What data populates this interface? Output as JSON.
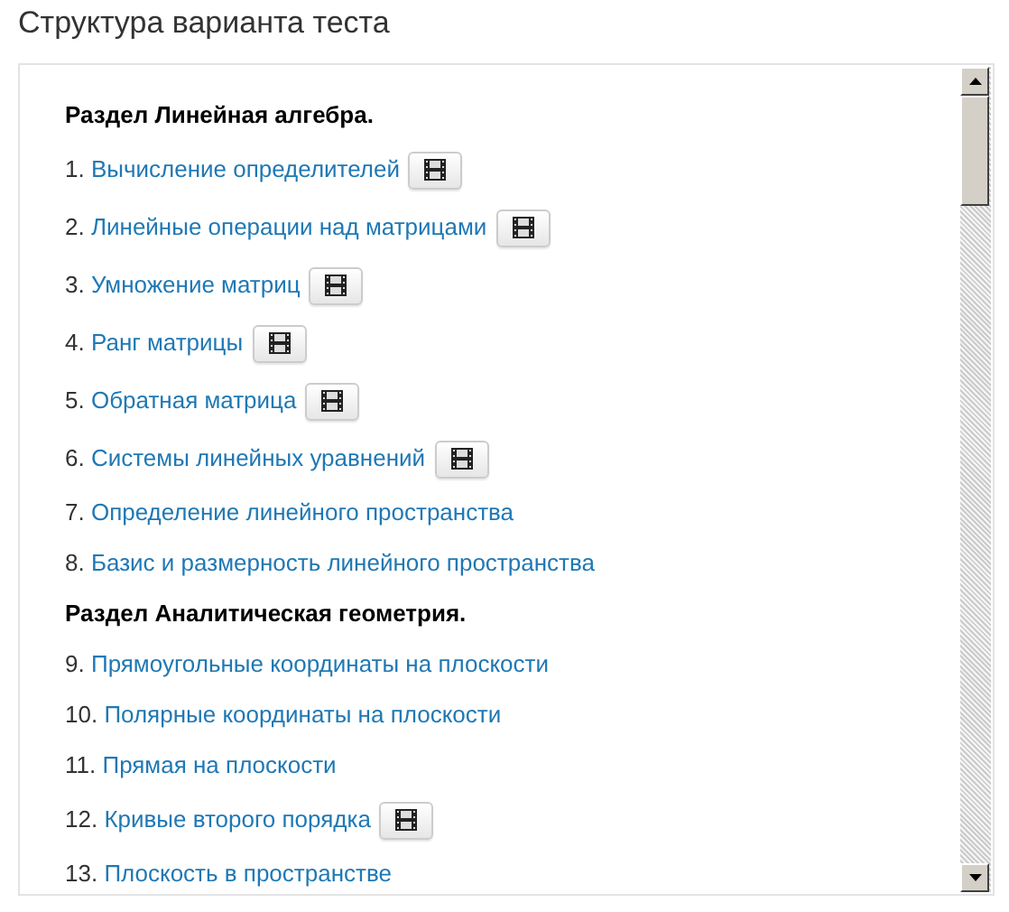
{
  "title": "Структура варианта теста",
  "sections": [
    {
      "heading": "Раздел Линейная алгебра.",
      "items": [
        {
          "number": "1.",
          "title": "Вычисление определителей",
          "video": true
        },
        {
          "number": "2.",
          "title": "Линейные операции над матрицами",
          "video": true
        },
        {
          "number": "3.",
          "title": "Умножение матриц",
          "video": true
        },
        {
          "number": "4.",
          "title": "Ранг матрицы",
          "video": true
        },
        {
          "number": "5.",
          "title": "Обратная матрица",
          "video": true
        },
        {
          "number": "6.",
          "title": "Системы линейных уравнений",
          "video": true
        },
        {
          "number": "7.",
          "title": "Определение линейного пространства",
          "video": false
        },
        {
          "number": "8.",
          "title": "Базис и размерность линейного пространства",
          "video": false
        }
      ]
    },
    {
      "heading": "Раздел Аналитическая геометрия.",
      "items": [
        {
          "number": "9.",
          "title": "Прямоугольные координаты на плоскости",
          "video": false
        },
        {
          "number": "10.",
          "title": "Полярные координаты на плоскости",
          "video": false
        },
        {
          "number": "11.",
          "title": "Прямая на плоскости",
          "video": false
        },
        {
          "number": "12.",
          "title": "Кривые второго порядка",
          "video": true
        },
        {
          "number": "13.",
          "title": "Плоскость в пространстве",
          "video": false
        }
      ]
    }
  ]
}
